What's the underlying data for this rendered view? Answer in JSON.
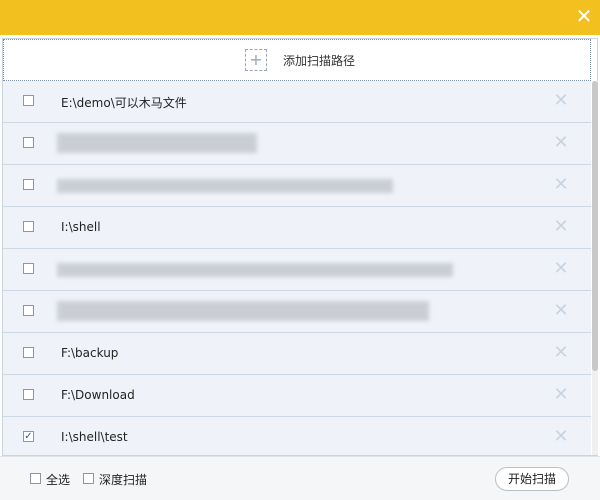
{
  "titlebar": {
    "close_glyph": "✕",
    "color": "#f2c01f"
  },
  "add_path": {
    "icon_glyph": "+",
    "label": "添加扫描路径"
  },
  "rows": [
    {
      "path": "E:\\demo\\可以木马文件",
      "checked": false
    },
    {
      "path": "",
      "checked": false,
      "redacted": true
    },
    {
      "path": "",
      "checked": false,
      "redacted": true
    },
    {
      "path": "I:\\shell",
      "checked": false
    },
    {
      "path": "",
      "checked": false,
      "redacted": true
    },
    {
      "path": "",
      "checked": false,
      "redacted": true
    },
    {
      "path": "F:\\backup",
      "checked": false
    },
    {
      "path": "F:\\Download",
      "checked": false
    },
    {
      "path": "I:\\shell\\test",
      "checked": true
    }
  ],
  "delete_glyph": "✕",
  "check_glyph": "✓",
  "footer": {
    "select_all_label": "全选",
    "deep_scan_label": "深度扫描",
    "start_button_label": "开始扫描"
  }
}
